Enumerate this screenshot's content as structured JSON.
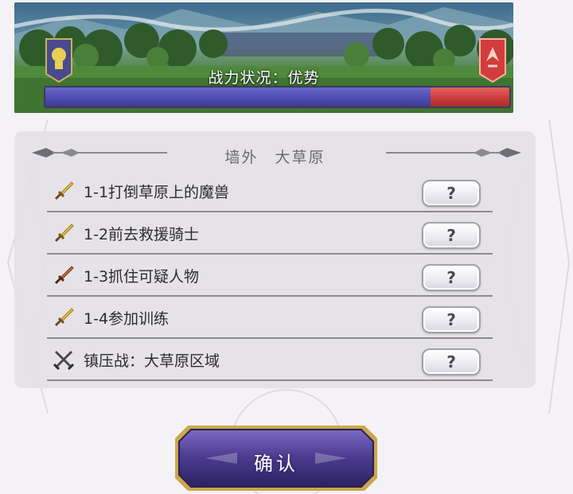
{
  "banner": {
    "power_label": "战力状况：优势",
    "power_ratio": 0.83,
    "ally_color": "#4f4cae",
    "enemy_color": "#c83c3c",
    "ally_emblem_icon": "lion-crest-icon",
    "enemy_emblem_icon": "dragon-crest-icon"
  },
  "panel": {
    "title": "墙外　大草原",
    "stages": [
      {
        "label": "1-1打倒草原上的魔兽",
        "icon": "gold-sword-icon",
        "button": "?"
      },
      {
        "label": "1-2前去救援骑士",
        "icon": "gold-sword-icon",
        "button": "?"
      },
      {
        "label": "1-3抓住可疑人物",
        "icon": "bronze-sword-icon",
        "button": "?"
      },
      {
        "label": "1-4参加训练",
        "icon": "gold-sword-icon",
        "button": "?"
      },
      {
        "label": "镇压战：大草原区域",
        "icon": "crossed-swords-icon",
        "button": "?"
      }
    ]
  },
  "confirm": {
    "label": "确认"
  }
}
